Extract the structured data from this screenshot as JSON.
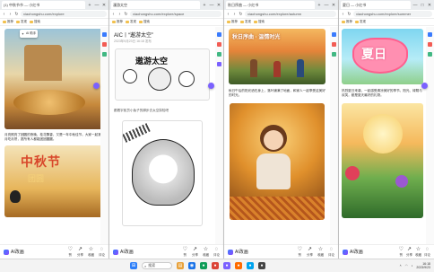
{
  "windows": [
    {
      "tab_title": "(1) 中秋节节 — 小红书",
      "url": "xiaohongshu.com/explore",
      "bookmarks": [
        "推荐",
        "发现",
        "搜索",
        "热门话题"
      ],
      "toolbar_label": "AI 助手",
      "posters": [
        "中秋节",
        "团圆"
      ],
      "body_text": "月亮照亮了团圆的夜晚，桂花飘香，又是一年中秋佳节。大家一起赏月吃月饼，愿所有人都能团团圆圆。",
      "brand": "AI改画"
    },
    {
      "tab_title": "漫游太空",
      "url": "xiaohongshu.com/explore/space",
      "bookmarks": [
        "推荐",
        "发现",
        "搜索"
      ],
      "caption_title": "AIC丨“遨游太空”",
      "meta": "2023年9月23日 16:18 发布",
      "poster": "遨游太空",
      "body_text": "跟着宇航员小兔子的脚步去太空探险吧",
      "brand": "AI改画"
    },
    {
      "tab_title": "秋日序曲 — 小红书",
      "url": "xiaohongshu.com/explore/autumn",
      "bookmarks": [
        "推荐",
        "发现",
        "搜索"
      ],
      "poster": "秋日序曲 · 温情时光",
      "body_text": "秋日午后的阳光洒在身上，落叶铺满了地面，和家人一起享受这美好的时光。",
      "brand": "AI改画"
    },
    {
      "tab_title": "夏日 — 小红书",
      "url": "xiaohongshu.com/explore/summer",
      "bookmarks": [
        "推荐",
        "发现"
      ],
      "poster": "夏日",
      "body_text": "热烈夏日来袭，一起感受清凉美好的季节。阳光、绿荫与欢笑，都是夏天最好的礼物。",
      "brand": "AI改画"
    }
  ],
  "actions": [
    "赞",
    "分享",
    "收藏",
    "评论"
  ],
  "window_controls": [
    "—",
    "□",
    "✕"
  ],
  "taskbar": {
    "search_placeholder": "搜索",
    "time": "16:18",
    "date": "2023/9/23"
  }
}
